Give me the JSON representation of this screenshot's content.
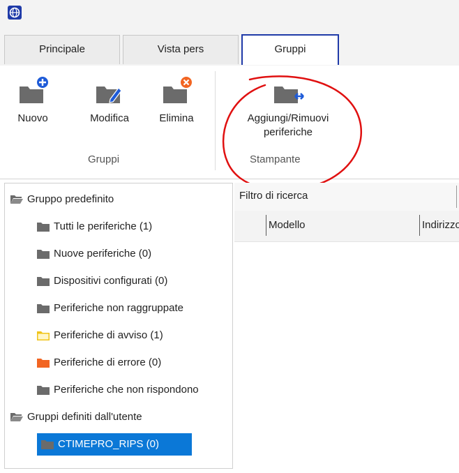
{
  "app": {
    "icon": "app-globe-icon"
  },
  "tabs": [
    {
      "label": "Principale",
      "active": false
    },
    {
      "label": "Vista pers",
      "active": false
    },
    {
      "label": "Gruppi",
      "active": true
    }
  ],
  "ribbon": {
    "groups": [
      {
        "label": "Gruppi",
        "buttons": [
          {
            "label": "Nuovo",
            "icon": "folder-add-icon"
          },
          {
            "label": "Modifica",
            "icon": "folder-edit-icon"
          },
          {
            "label": "Elimina",
            "icon": "folder-delete-icon"
          }
        ]
      },
      {
        "label": "Stampante",
        "buttons": [
          {
            "label_line1": "Aggiungi/Rimuovi",
            "label_line2": "periferiche",
            "icon": "folder-transfer-icon"
          }
        ]
      }
    ]
  },
  "tree": {
    "default_group": {
      "label": "Gruppo predefinito",
      "items": [
        {
          "label": "Tutti le periferiche (1)",
          "icon": "folder-icon"
        },
        {
          "label": "Nuove periferiche (0)",
          "icon": "folder-icon"
        },
        {
          "label": "Dispositivi configurati (0)",
          "icon": "folder-icon"
        },
        {
          "label": "Periferiche non raggruppate",
          "icon": "folder-icon"
        },
        {
          "label": "Periferiche di avviso (1)",
          "icon": "folder-warning-icon"
        },
        {
          "label": "Periferiche di errore (0)",
          "icon": "folder-error-icon"
        },
        {
          "label": "Periferiche che non rispondono",
          "icon": "folder-icon"
        }
      ]
    },
    "user_group": {
      "label": "Gruppi definiti dall'utente",
      "items": [
        {
          "label": "CTIMEPRO_RIPS (0)",
          "icon": "folder-icon",
          "selected": true
        }
      ]
    }
  },
  "content": {
    "filter_label": "Filtro di ricerca",
    "columns": [
      "Modello",
      "Indirizzo"
    ]
  },
  "colors": {
    "active_tab_border": "#1f3aa8",
    "selection": "#0b78d7",
    "annotation": "#e01010",
    "folder_gray": "#6b6b6b",
    "warning_folder": "#f0c419",
    "error_folder": "#f26522",
    "add_badge": "#1e5bd8",
    "delete_badge": "#f26522"
  }
}
